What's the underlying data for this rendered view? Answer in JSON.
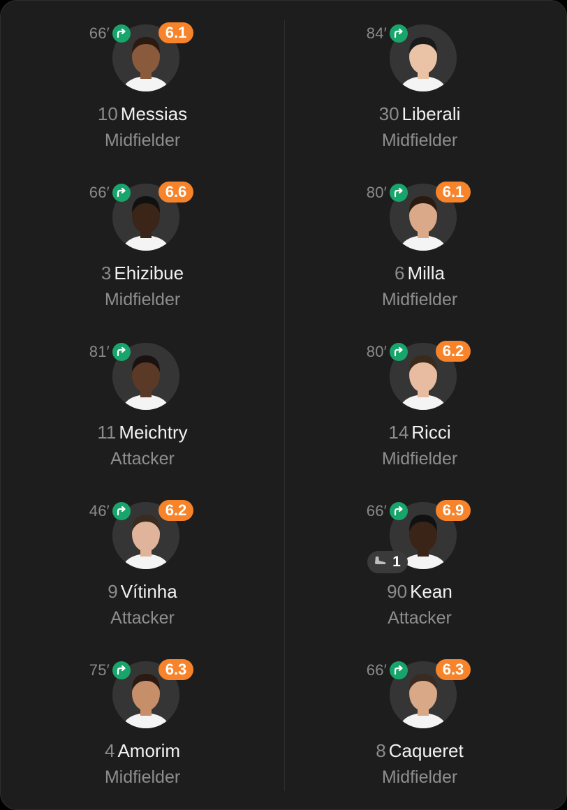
{
  "left": [
    {
      "minute": "66′",
      "rating": "6.1",
      "number": "10",
      "name": "Messias",
      "position": "Midfielder"
    },
    {
      "minute": "66′",
      "rating": "6.6",
      "number": "3",
      "name": "Ehizibue",
      "position": "Midfielder"
    },
    {
      "minute": "81′",
      "rating": "",
      "number": "11",
      "name": "Meichtry",
      "position": "Attacker"
    },
    {
      "minute": "46′",
      "rating": "6.2",
      "number": "9",
      "name": "Vítinha",
      "position": "Attacker"
    },
    {
      "minute": "75′",
      "rating": "6.3",
      "number": "4",
      "name": "Amorim",
      "position": "Midfielder"
    }
  ],
  "right": [
    {
      "minute": "84′",
      "rating": "",
      "number": "30",
      "name": "Liberali",
      "position": "Midfielder"
    },
    {
      "minute": "80′",
      "rating": "6.1",
      "number": "6",
      "name": "Milla",
      "position": "Midfielder"
    },
    {
      "minute": "80′",
      "rating": "6.2",
      "number": "14",
      "name": "Ricci",
      "position": "Midfielder"
    },
    {
      "minute": "66′",
      "rating": "6.9",
      "number": "90",
      "name": "Kean",
      "position": "Attacker",
      "goals": "1"
    },
    {
      "minute": "66′",
      "rating": "6.3",
      "number": "8",
      "name": "Caqueret",
      "position": "Midfielder"
    }
  ],
  "icons": {
    "substitution": "sub-off-arrow-icon",
    "goal": "boot-icon",
    "avatar": "player-photo"
  },
  "colors": {
    "rating": "#f7842a",
    "substitution": "#17a56b",
    "background": "#1d1d1d"
  }
}
